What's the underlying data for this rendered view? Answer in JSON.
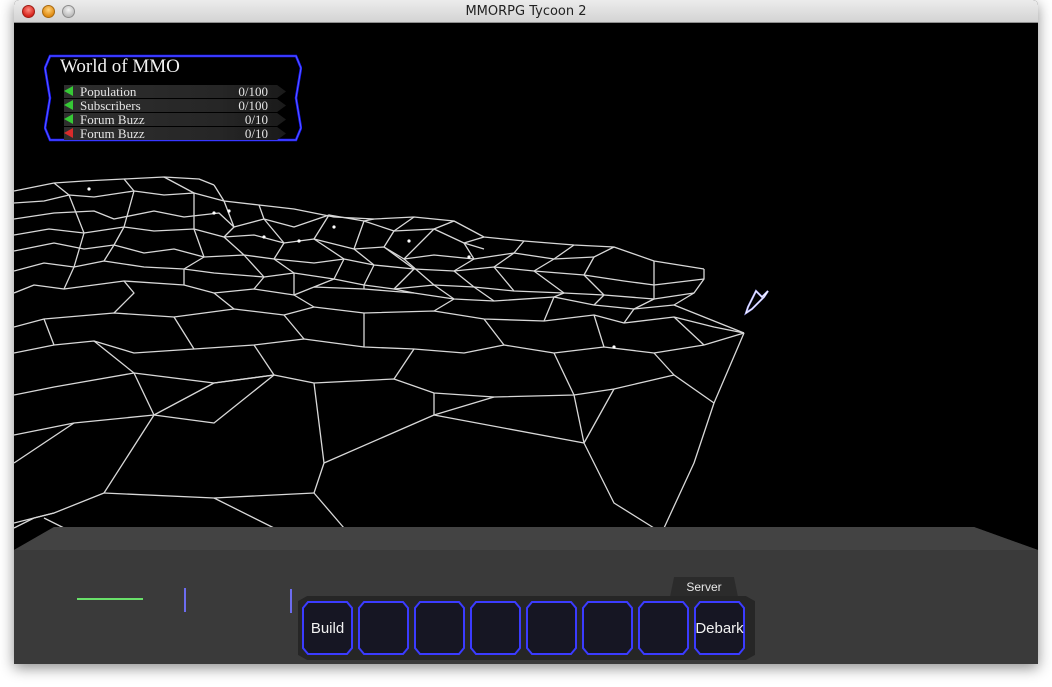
{
  "window": {
    "title": "MMORPG Tycoon 2"
  },
  "stats_panel": {
    "title": "World of MMO",
    "rows": [
      {
        "label": "Population",
        "value": "0/100",
        "trend": "up"
      },
      {
        "label": "Subscribers",
        "value": "0/100",
        "trend": "up"
      },
      {
        "label": "Forum Buzz",
        "value": "0/10",
        "trend": "up"
      },
      {
        "label": "Forum Buzz",
        "value": "0/10",
        "trend": "down"
      }
    ]
  },
  "toolbar": {
    "server_tab_label": "Server",
    "slots": [
      {
        "label": "Build"
      },
      {
        "label": ""
      },
      {
        "label": ""
      },
      {
        "label": ""
      },
      {
        "label": ""
      },
      {
        "label": ""
      },
      {
        "label": ""
      },
      {
        "label": "Debark"
      }
    ]
  },
  "colors": {
    "panel_border": "#1a1aff",
    "slot_border": "#3b3bff",
    "trend_up": "#36c936",
    "trend_down": "#d92b2b",
    "mesh_line": "#d8d8d8",
    "hud_floor": "#3a3a3a",
    "background": "#000000"
  },
  "icons": {
    "cursor": "sword-cursor-icon"
  }
}
